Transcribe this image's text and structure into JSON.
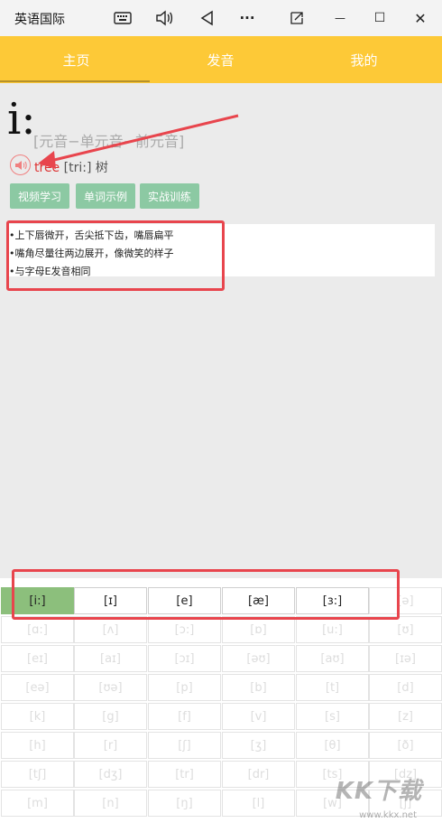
{
  "app": {
    "title": "英语国际"
  },
  "titlebar": {
    "keyboard_icon": "keyboard-icon",
    "volume_icon": "volume-icon",
    "back_icon": "back-icon",
    "more_label": "···",
    "snap_icon": "snap-icon",
    "minimize_label": "—",
    "maximize_label": "☐",
    "close_label": "✕"
  },
  "nav": {
    "tabs": [
      {
        "label": "主页"
      },
      {
        "label": "发音"
      },
      {
        "label": "我的"
      }
    ]
  },
  "phoneme": {
    "symbol": "i:",
    "category": "[元音−单元音−前元音]",
    "word": "tree",
    "ipa": "[tri:]",
    "meaning": "树"
  },
  "actions": [
    {
      "label": "视频学习"
    },
    {
      "label": "单词示例"
    },
    {
      "label": "实战训练"
    }
  ],
  "tips": [
    "•上下唇微开，舌尖抵下齿，嘴唇扁平",
    "•嘴角尽量往两边展开，像微笑的样子",
    "•与字母E发音相同"
  ],
  "grid": [
    [
      "[i:]",
      "[ɪ]",
      "[e]",
      "[æ]",
      "[ɜ:]",
      "[ə]"
    ],
    [
      "[ɑ:]",
      "[ʌ]",
      "[ɔ:]",
      "[ɒ]",
      "[u:]",
      "[ʊ]"
    ],
    [
      "[eɪ]",
      "[aɪ]",
      "[ɔɪ]",
      "[əʊ]",
      "[aʊ]",
      "[ɪə]"
    ],
    [
      "[eə]",
      "[ʊə]",
      "[p]",
      "[b]",
      "[t]",
      "[d]"
    ],
    [
      "[k]",
      "[g]",
      "[f]",
      "[v]",
      "[s]",
      "[z]"
    ],
    [
      "[h]",
      "[r]",
      "[ʃ]",
      "[ʒ]",
      "[θ]",
      "[ð]"
    ],
    [
      "[tʃ]",
      "[dʒ]",
      "[tr]",
      "[dr]",
      "[ts]",
      "[dz]"
    ],
    [
      "[m]",
      "[n]",
      "[ŋ]",
      "[l]",
      "[w]",
      "[j]"
    ]
  ],
  "watermark": {
    "text": "KK下载",
    "url": "www.kkx.net"
  },
  "colors": {
    "nav_bg": "#fdc937",
    "action_btn": "#8cc9a3",
    "active_cell": "#8cbf7c",
    "annotation": "#e8454d"
  }
}
